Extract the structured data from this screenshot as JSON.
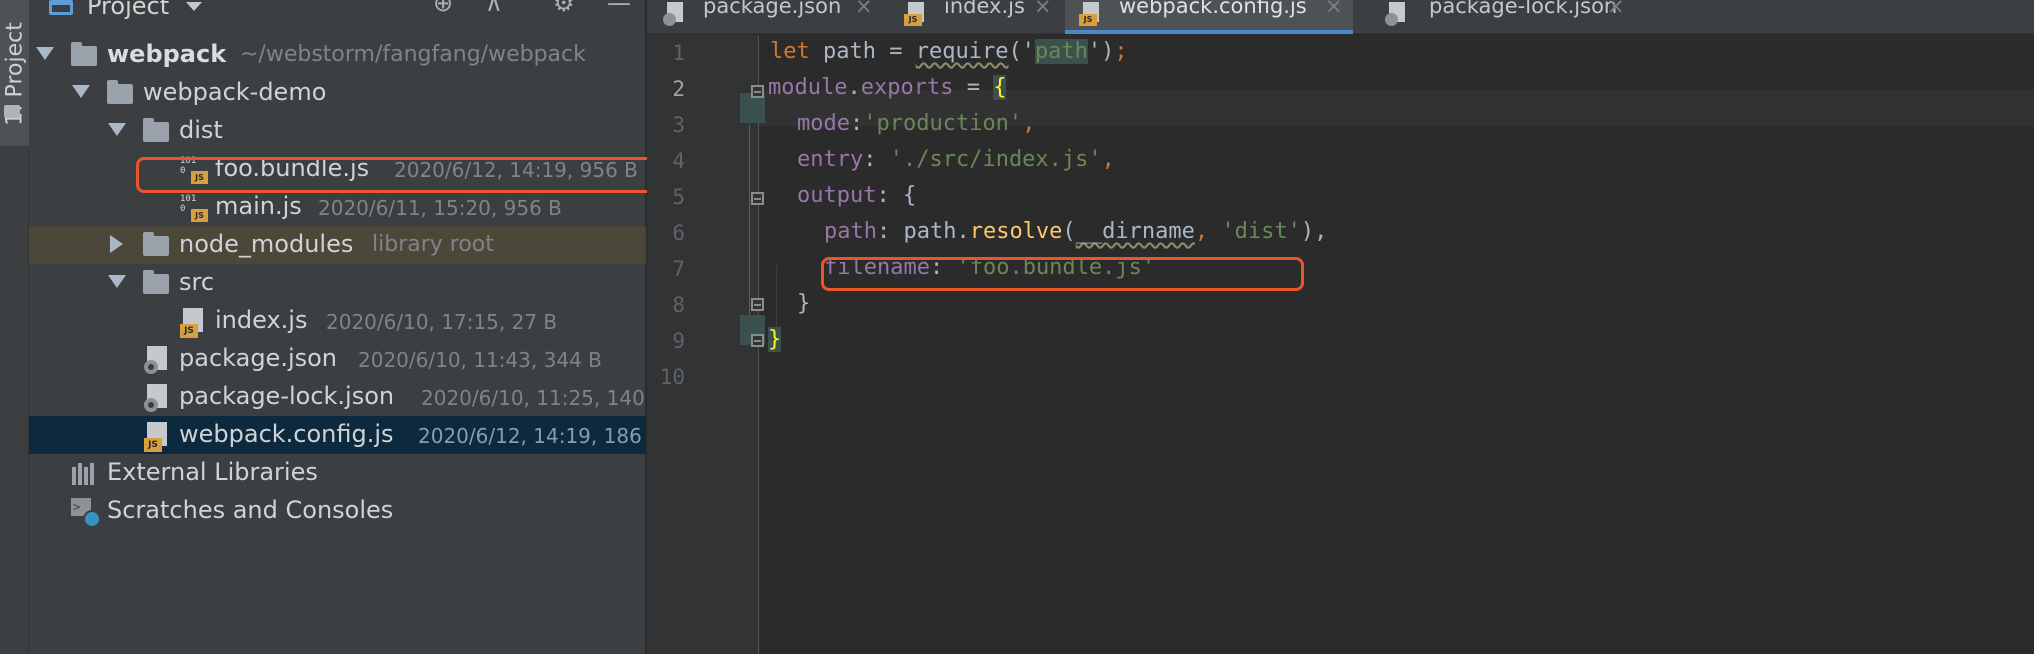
{
  "stripe": {
    "label": "1: Project"
  },
  "project_panel": {
    "title": "Project",
    "tree": [
      {
        "name": "webpack",
        "path": "~/webstorm/fangfang/webpack"
      },
      {
        "name": "webpack-demo"
      },
      {
        "name": "dist"
      },
      {
        "name": "foo.bundle.js",
        "meta": "2020/6/12, 14:19, 956 B"
      },
      {
        "name": "main.js",
        "meta": "2020/6/11, 15:20, 956 B"
      },
      {
        "name": "node_modules",
        "meta": "library root"
      },
      {
        "name": "src"
      },
      {
        "name": "index.js",
        "meta": "2020/6/10, 17:15, 27 B"
      },
      {
        "name": "package.json",
        "meta": "2020/6/10, 11:43, 344 B"
      },
      {
        "name": "package-lock.json",
        "meta": "2020/6/10, 11:25, 140"
      },
      {
        "name": "webpack.config.js",
        "meta": "2020/6/12, 14:19, 186"
      },
      {
        "name": "External Libraries"
      },
      {
        "name": "Scratches and Consoles"
      }
    ]
  },
  "tabs": [
    {
      "label": "package.json",
      "close": "×"
    },
    {
      "label": "index.js",
      "close": "×"
    },
    {
      "label": "webpack.config.js",
      "close": "×",
      "active": true
    },
    {
      "label": "package-lock.json",
      "close": "×"
    }
  ],
  "editor": {
    "line_numbers": [
      "1",
      "2",
      "3",
      "4",
      "5",
      "6",
      "7",
      "8",
      "9",
      "10"
    ],
    "tokens": {
      "l1_let": "let",
      "l1_path": " path = ",
      "l1_require": "require",
      "l1_open": "('",
      "l1_str": "path",
      "l1_close": "')",
      "l1_semi": ";",
      "l2_module": "module",
      "l2_dot": ".",
      "l2_exports": "exports",
      "l2_eq": " = ",
      "l2_brace": "{",
      "l3_key": "mode",
      "l3_colon": ":",
      "l3_str": "'production'",
      "l3_comma": ",",
      "l4_key": "entry",
      "l4_colon": ": ",
      "l4_str": "'./src/index.js'",
      "l4_comma": ",",
      "l5_key": "output",
      "l5_rest": ": {",
      "l6_key": "path",
      "l6_colon": ": path.",
      "l6_fn": "resolve",
      "l6_open": "(",
      "l6_dirname": "__dirname",
      "l6_comma": ", ",
      "l6_str": "'dist'",
      "l6_close": "),",
      "l7_key": "filename",
      "l7_colon": ": ",
      "l7_str": "'foo.bundle.js'",
      "l8_brace": "}",
      "l9_brace": "}"
    }
  }
}
